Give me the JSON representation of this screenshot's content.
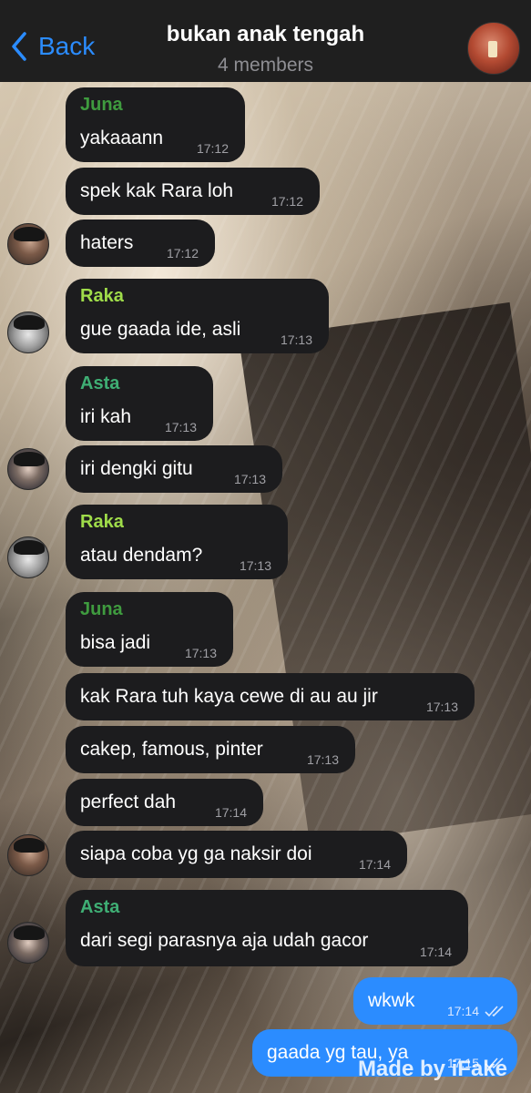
{
  "header": {
    "back_label": "Back",
    "title": "bukan anak tengah",
    "subtitle": "4 members",
    "group_avatar_icon": "group-avatar-image"
  },
  "colors": {
    "accent": "#2b8cff",
    "incoming_bubble": "#1c1c1e",
    "outgoing_bubble": "#2b8cff",
    "juna": "#3f9b3f",
    "raka": "#9fdc4a",
    "asta": "#3fae74"
  },
  "messages": [
    {
      "sender": "Juna",
      "text": "yakaaann",
      "time": "17:12"
    },
    {
      "sender": "",
      "text": "spek kak Rara loh",
      "time": "17:12"
    },
    {
      "sender": "",
      "text": "haters",
      "time": "17:12"
    },
    {
      "sender": "Raka",
      "text": "gue gaada ide, asli",
      "time": "17:13"
    },
    {
      "sender": "Asta",
      "text": "iri kah",
      "time": "17:13"
    },
    {
      "sender": "",
      "text": "iri dengki gitu",
      "time": "17:13"
    },
    {
      "sender": "Raka",
      "text": "atau dendam?",
      "time": "17:13"
    },
    {
      "sender": "Juna",
      "text": "bisa jadi",
      "time": "17:13"
    },
    {
      "sender": "",
      "text": "kak Rara tuh kaya cewe di au au jir",
      "time": "17:13"
    },
    {
      "sender": "",
      "text": "cakep, famous, pinter",
      "time": "17:13"
    },
    {
      "sender": "",
      "text": "perfect dah",
      "time": "17:14"
    },
    {
      "sender": "",
      "text": "siapa coba yg ga naksir doi",
      "time": "17:14"
    },
    {
      "sender": "Asta",
      "text": "dari segi parasnya aja udah gacor",
      "time": "17:14"
    },
    {
      "sender": "me",
      "text": "wkwk",
      "time": "17:14",
      "status": "read"
    },
    {
      "sender": "me",
      "text": "gaada yg tau, ya",
      "time": "17:15",
      "status": "read"
    }
  ],
  "watermark": "Made by iFake"
}
